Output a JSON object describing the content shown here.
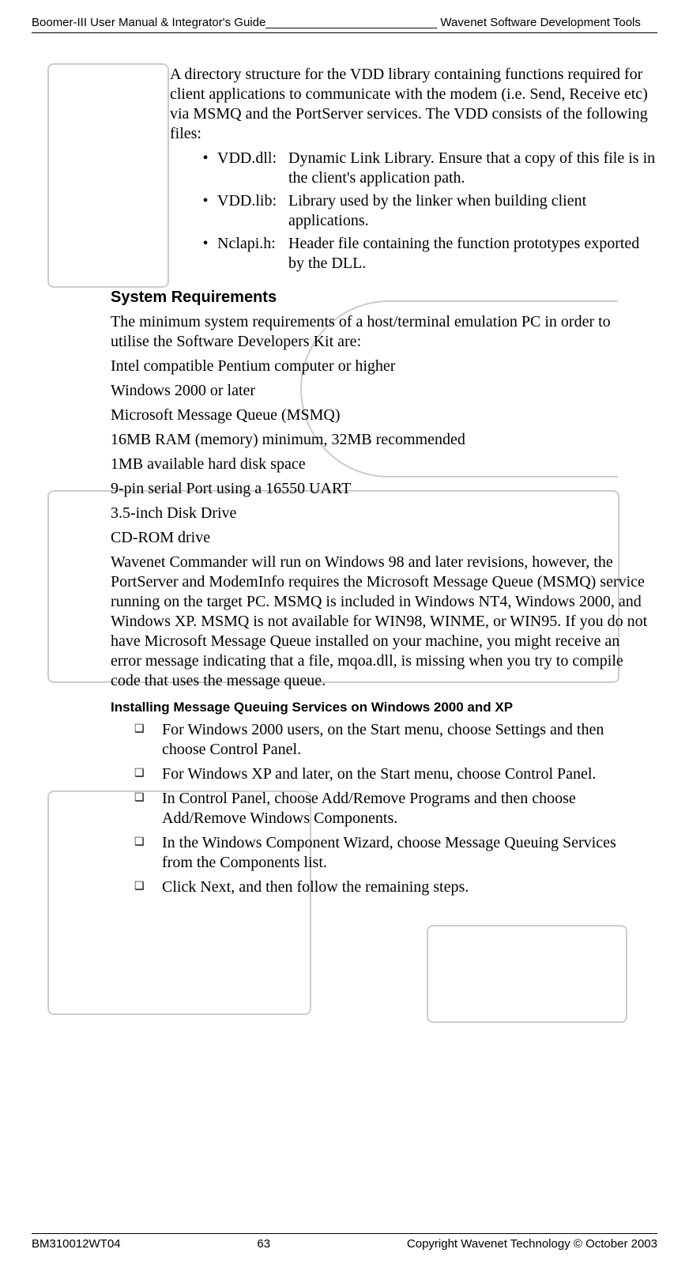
{
  "header": {
    "left": "Boomer-III User Manual & Integrator's Guide__________________________",
    "right": " Wavenet Software Development Tools"
  },
  "intro": "A directory structure for the VDD library containing functions required for client applications to communicate with the modem (i.e. Send, Receive etc) via MSMQ and the PortServer services. The VDD consists of the following files:",
  "files": [
    {
      "name": "VDD.dll:",
      "desc": "Dynamic Link Library. Ensure that a copy of this file is in the client's application path."
    },
    {
      "name": "VDD.lib:",
      "desc": "Library used by the linker when building client applications."
    },
    {
      "name": "Nclapi.h:",
      "desc": "Header file containing the function prototypes exported by the DLL."
    }
  ],
  "sysreq_title": "System Requirements",
  "sysreq_intro": "The minimum system requirements of a host/terminal emulation PC in order to utilise the Software Developers Kit are:",
  "reqs": [
    "Intel compatible Pentium computer or higher",
    "Windows 2000 or later",
    "Microsoft Message Queue (MSMQ)",
    "16MB RAM (memory) minimum, 32MB recommended",
    "1MB available hard disk space",
    "9-pin serial Port using a 16550 UART",
    "3.5-inch Disk Drive",
    "CD-ROM drive"
  ],
  "commander": "Wavenet Commander will run on Windows 98 and later revisions, however, the PortServer and ModemInfo requires the Microsoft Message Queue (MSMQ) service running on the target PC. MSMQ is included in Windows NT4, Windows 2000, and Windows XP. MSMQ is not available for WIN98, WINME, or WIN95. If you do not have Microsoft Message Queue installed on your machine, you might receive an error message indicating that a file, mqoa.dll, is missing when you try to compile code that uses the message queue.",
  "install_title": "Installing Message Queuing Services on Windows 2000 and XP",
  "steps": [
    "For Windows 2000 users, on the Start menu, choose Settings and then choose Control Panel.",
    "For Windows XP and later, on the Start menu, choose Control Panel.",
    "In Control Panel, choose Add/Remove Programs and then choose Add/Remove Windows Components.",
    "In the Windows Component Wizard, choose Message Queuing Services from the Components list.",
    "Click Next, and then follow the remaining steps."
  ],
  "footer": {
    "left": "BM310012WT04",
    "center": "63",
    "right": "Copyright Wavenet Technology © October 2003"
  }
}
